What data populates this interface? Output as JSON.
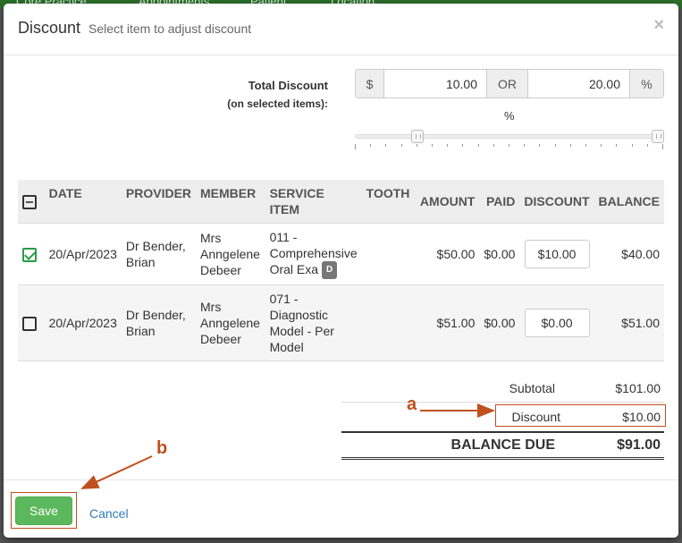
{
  "backdrop": {
    "nav_items": [
      "Core Practice",
      "Appointments",
      "Patient",
      "Location"
    ]
  },
  "modal": {
    "title": "Discount",
    "subtitle": "Select item to adjust discount",
    "close_icon": "close-icon"
  },
  "total_discount": {
    "label": "Total Discount",
    "sub_label": "(on selected items):",
    "currency_symbol": "$",
    "amount_value": "10.00",
    "or_label": "OR",
    "percent_value": "20.00",
    "percent_symbol": "%",
    "slider_caption": "%",
    "slider_level": 0.19
  },
  "table": {
    "headers": {
      "date": "DATE",
      "provider": "PROVIDER",
      "member": "MEMBER",
      "service_item": "SERVICE ITEM",
      "tooth": "TOOTH",
      "amount": "AMOUNT",
      "paid": "PAID",
      "discount": "DISCOUNT",
      "balance": "BALANCE"
    },
    "rows": [
      {
        "checked": true,
        "date": "20/Apr/2023",
        "provider": "Dr Bender, Brian",
        "member": "Mrs Anngelene Debeer",
        "service_item": "011 - Comprehensive Oral Exa",
        "badge": "D",
        "tooth": "",
        "amount": "$50.00",
        "paid": "$0.00",
        "discount": "$10.00",
        "balance": "$40.00"
      },
      {
        "checked": false,
        "date": "20/Apr/2023",
        "provider": "Dr Bender, Brian",
        "member": "Mrs Anngelene Debeer",
        "service_item": "071 - Diagnostic Model - Per Model",
        "badge": "",
        "tooth": "",
        "amount": "$51.00",
        "paid": "$0.00",
        "discount": "$0.00",
        "balance": "$51.00"
      }
    ]
  },
  "totals": {
    "subtotal_label": "Subtotal",
    "subtotal_value": "$101.00",
    "discount_label": "Discount",
    "discount_value": "$10.00",
    "balance_label": "BALANCE DUE",
    "balance_value": "$91.00"
  },
  "footer": {
    "save_label": "Save",
    "cancel_label": "Cancel"
  },
  "annotations": {
    "a": "a",
    "b": "b",
    "color": "#c0501f"
  }
}
